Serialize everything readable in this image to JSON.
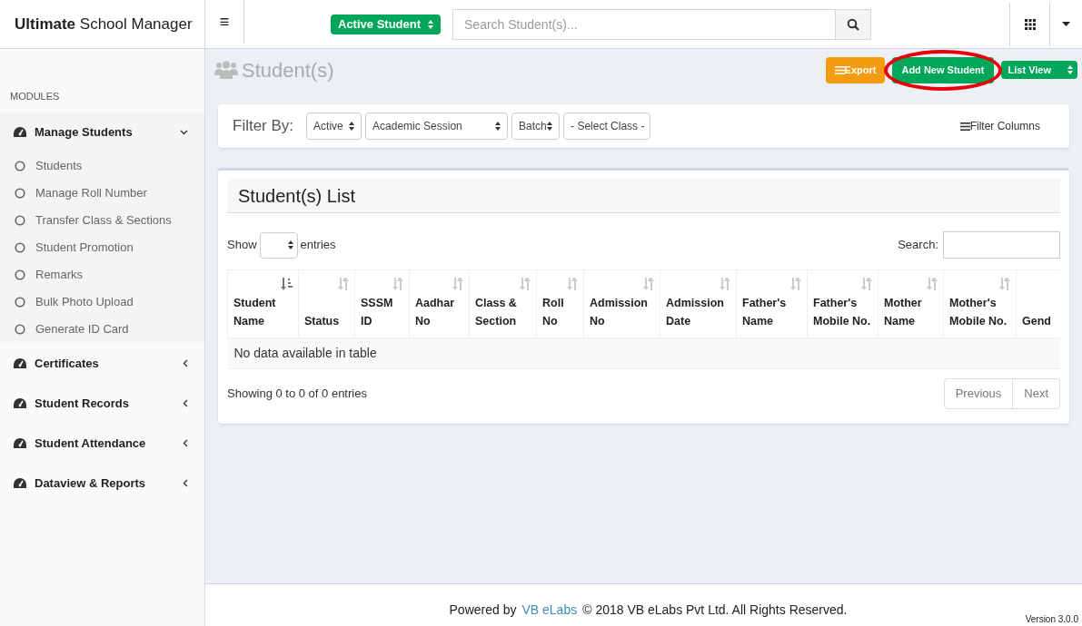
{
  "brand": {
    "bold": "Ultimate",
    "rest": "School Manager"
  },
  "header": {
    "menu_icon": "≡",
    "student_filter": "Active Student",
    "search": {
      "placeholder": "Search Student(s)..."
    }
  },
  "sidebar": {
    "heading": "MODULES",
    "groups": [
      {
        "label": "Manage Students",
        "expanded": true,
        "children": [
          {
            "label": "Students"
          },
          {
            "label": "Manage Roll Number"
          },
          {
            "label": "Transfer Class & Sections"
          },
          {
            "label": "Student Promotion"
          },
          {
            "label": "Remarks"
          },
          {
            "label": "Bulk Photo Upload"
          },
          {
            "label": "Generate ID Card"
          }
        ]
      },
      {
        "label": "Certificates",
        "expanded": false
      },
      {
        "label": "Student Records",
        "expanded": false
      },
      {
        "label": "Student Attendance",
        "expanded": false
      },
      {
        "label": "Dataview & Reports",
        "expanded": false
      }
    ]
  },
  "page": {
    "title": "Student(s)",
    "actions": [
      {
        "kind": "button",
        "label": "Export",
        "color": "#f39c12",
        "highlighted": false
      },
      {
        "kind": "button",
        "label": "Add New Student",
        "color": "#00a65a",
        "highlighted": true
      },
      {
        "kind": "select",
        "label": "List View",
        "color": "#00a65a",
        "highlighted": false
      }
    ]
  },
  "filter": {
    "label": "Filter By:",
    "selects": [
      "Active",
      "Academic Session",
      "Batch",
      "- Select Class -"
    ],
    "columns_button": "Filter Columns"
  },
  "list": {
    "title": "Student(s) List",
    "show_label": "Show",
    "entries_label": "entries",
    "search_label": "Search:",
    "columns": [
      {
        "label": "Student Name",
        "sorted": true
      },
      {
        "label": "Status",
        "sorted": false
      },
      {
        "label": "SSSM ID",
        "sorted": false
      },
      {
        "label": "Aadhar No",
        "sorted": false
      },
      {
        "label": "Class & Section",
        "sorted": false
      },
      {
        "label": "Roll No",
        "sorted": false
      },
      {
        "label": "Admission No",
        "sorted": false
      },
      {
        "label": "Admission Date",
        "sorted": false
      },
      {
        "label": "Father's Name",
        "sorted": false
      },
      {
        "label": "Father's Mobile No.",
        "sorted": false
      },
      {
        "label": "Mother Name",
        "sorted": false
      },
      {
        "label": "Mother's Mobile No.",
        "sorted": false
      },
      {
        "label": "Gend"
      }
    ],
    "empty": "No data available in table",
    "info": "Showing 0 to 0 of 0 entries",
    "pager": [
      "Previous",
      "Next"
    ]
  },
  "footer": {
    "before": "Powered by",
    "link": "VB eLabs",
    "after": "© 2018 VB eLabs Pvt Ltd. All Rights Reserved.",
    "version": "Version 3.0.0"
  }
}
